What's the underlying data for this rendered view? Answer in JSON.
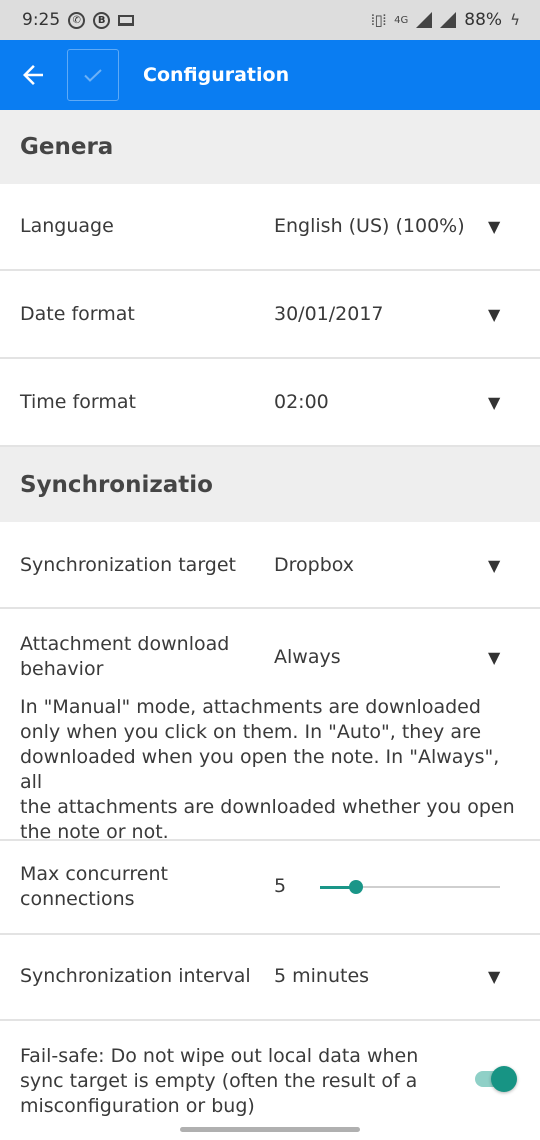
{
  "status_bar": {
    "time": "9:25",
    "icons": [
      "whatsapp-icon",
      "b-icon",
      "laptop-icon",
      "vibrate-icon",
      "4g-icon",
      "signal-icon"
    ],
    "network": "4G",
    "battery": "88%"
  },
  "app_bar": {
    "title": "Configuration",
    "accent_color": "#0a7df2"
  },
  "sections": {
    "general": "Genera",
    "sync": "Synchronizatio"
  },
  "settings": {
    "language": {
      "label": "Language",
      "value": "English (US) (100%)"
    },
    "date_format": {
      "label": "Date format",
      "value": "30/01/2017"
    },
    "time_format": {
      "label": "Time format",
      "value": "02:00"
    },
    "sync_target": {
      "label": "Synchronization target",
      "value": "Dropbox"
    },
    "attachment": {
      "label_line1": "Attachment download",
      "label_line2": "behavior",
      "value": "Always",
      "description": [
        "In \"Manual\" mode, attachments are downloaded",
        "only when you click on them. In \"Auto\", they are",
        "downloaded when you open the note. In \"Always\", all",
        "the attachments are downloaded whether you open",
        "the note or not."
      ]
    },
    "max_connections": {
      "label_line1": "Max concurrent",
      "label_line2": "connections",
      "value": "5",
      "slider_fraction": 0.2
    },
    "sync_interval": {
      "label": "Synchronization interval",
      "value": "5 minutes"
    },
    "fail_safe": {
      "label_lines": [
        "Fail-safe: Do not wipe out local data when",
        "sync target is empty (often the result of a",
        "misconfiguration or bug)"
      ],
      "enabled": true
    }
  },
  "dropdown_glyph": "▼"
}
